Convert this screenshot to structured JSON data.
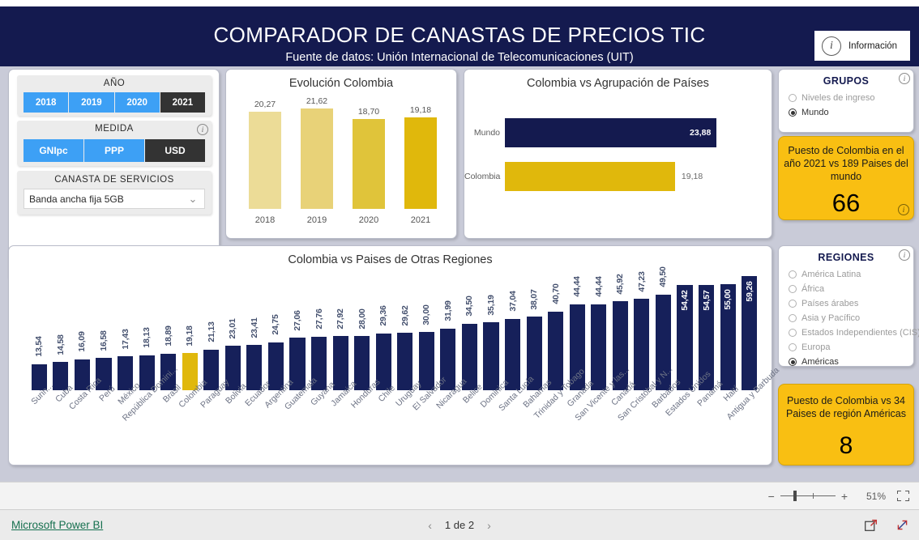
{
  "header": {
    "title": "COMPARADOR DE CANASTAS DE PRECIOS TIC",
    "subtitle": "Fuente de datos: Unión Internacional de Telecomunicaciones (UIT)",
    "info_button_label": "Información",
    "info_icon": "info-circle-icon",
    "bg_color": "#141a4f"
  },
  "slicers": {
    "anio": {
      "title": "AÑO",
      "options": [
        "2018",
        "2019",
        "2020",
        "2021"
      ],
      "selected": "2021"
    },
    "medida": {
      "title": "MEDIDA",
      "options": [
        "GNIpc",
        "PPP",
        "USD"
      ],
      "selected": "USD",
      "info_icon": "info-circle-icon"
    },
    "canasta": {
      "title": "CANASTA DE SERVICIOS",
      "selected": "Banda ancha fija 5GB",
      "placeholder": "Banda ancha fija 5GB",
      "chevron_icon": "chevron-down-icon"
    }
  },
  "grupos": {
    "title": "GRUPOS",
    "info_icon": "info-circle-icon",
    "options": [
      "Niveles de ingreso",
      "Mundo"
    ],
    "selected": "Mundo"
  },
  "regiones": {
    "title": "REGIONES",
    "info_icon": "info-circle-icon",
    "options": [
      "América Latina",
      "África",
      "Países árabes",
      "Asia y Pacífico",
      "Estados Independientes (CIS)",
      "Europa",
      "Américas"
    ],
    "selected": "Américas"
  },
  "kpi_mundo": {
    "text": "Puesto de Colombia en el año 2021 vs 189 Paises del mundo",
    "value": "66",
    "info_icon": "info-circle-icon",
    "color": "#f9bf12"
  },
  "kpi_region": {
    "text": "Puesto de Colombia vs 34 Paises de región Américas",
    "value": "8",
    "color": "#f9bf12"
  },
  "colors": {
    "navy": "#141a4f",
    "bar_navy": "#16205a",
    "gold": "#e0b80c",
    "accent_blue": "#3da0f5",
    "selected_dark": "#333333",
    "canvas": "#c9cbd8"
  },
  "chart_data": [
    {
      "id": "evolucion_colombia",
      "type": "bar",
      "title": "Evolución Colombia",
      "categories": [
        "2018",
        "2019",
        "2020",
        "2021"
      ],
      "values": [
        20.27,
        21.62,
        18.7,
        19.18
      ],
      "value_labels": [
        "20,27",
        "21,62",
        "18,70",
        "19,18"
      ],
      "bar_colors": [
        "#ecdc97",
        "#e8d278",
        "#e0c43a",
        "#e0b80c"
      ],
      "xlabel": "",
      "ylabel": "",
      "ylim": [
        0,
        23.5
      ],
      "grid": false,
      "legend": "none"
    },
    {
      "id": "colombia_vs_agrupacion",
      "type": "bar",
      "orientation": "horizontal",
      "title": "Colombia vs Agrupación de Países",
      "categories": [
        "Mundo",
        "Colombia"
      ],
      "values": [
        23.88,
        19.18
      ],
      "value_labels": [
        "23,88",
        "19,18"
      ],
      "bar_colors": [
        "#141a4f",
        "#e0b80c"
      ],
      "xlabel": "",
      "ylabel": "",
      "xlim": [
        0,
        26.5
      ],
      "grid": false,
      "legend": "none"
    },
    {
      "id": "colombia_vs_otras_regiones",
      "type": "bar",
      "title": "Colombia vs Paises de Otras Regiones",
      "xlabel": "",
      "ylabel": "",
      "ylim": [
        0,
        62
      ],
      "grid": false,
      "legend": "none",
      "highlight_category": "Colombia",
      "highlight_color": "#e0b80c",
      "default_color": "#16205a",
      "categories": [
        "Surin...",
        "Cuba",
        "Costa Rica",
        "Perú",
        "México",
        "República Domini...",
        "Brasil",
        "Colombia",
        "Paraguay",
        "Bolivia",
        "Ecuador",
        "Argentina",
        "Guatemala",
        "Guyana",
        "Jamaica",
        "Honduras",
        "Chile",
        "Uruguay",
        "El Salvador",
        "Nicaragua",
        "Belice",
        "Dominica",
        "Santa Lucía",
        "Bahamas",
        "Trinidad y Tobago",
        "Granada",
        "San Vicente y las...",
        "Canadá",
        "San Cristóbal y N...",
        "Barbados",
        "Estados Unidos",
        "Panamá",
        "Haití",
        "Antigua y Barbuda"
      ],
      "values": [
        13.54,
        14.58,
        16.09,
        16.58,
        17.43,
        18.13,
        18.89,
        19.18,
        21.13,
        23.01,
        23.41,
        24.75,
        27.06,
        27.76,
        27.92,
        28.0,
        29.36,
        29.62,
        30.0,
        31.99,
        34.5,
        35.19,
        37.04,
        38.07,
        40.7,
        44.44,
        44.44,
        45.92,
        47.23,
        49.5,
        54.42,
        54.57,
        55.0,
        59.26
      ],
      "value_labels": [
        "13,54",
        "14,58",
        "16,09",
        "16,58",
        "17,43",
        "18,13",
        "18,89",
        "19,18",
        "21,13",
        "23,01",
        "23,41",
        "24,75",
        "27,06",
        "27,76",
        "27,92",
        "28,00",
        "29,36",
        "29,62",
        "30,00",
        "31,99",
        "34,50",
        "35,19",
        "37,04",
        "38,07",
        "40,70",
        "44,44",
        "44,44",
        "45,92",
        "47,23",
        "49,50",
        "54,42",
        "54,57",
        "55,00",
        "59,26"
      ],
      "labels_inside_from_index": 30
    }
  ],
  "statusbar": {
    "zoom_percent": "51%",
    "minus_label": "−",
    "plus_label": "+",
    "fit_icon": "fit-to-page-icon"
  },
  "footer": {
    "brand": "Microsoft Power BI",
    "page_text": "1 de 2",
    "prev_icon": "chevron-left-icon",
    "next_icon": "chevron-right-icon",
    "share_icon": "share-icon",
    "fullscreen_icon": "fullscreen-icon"
  }
}
